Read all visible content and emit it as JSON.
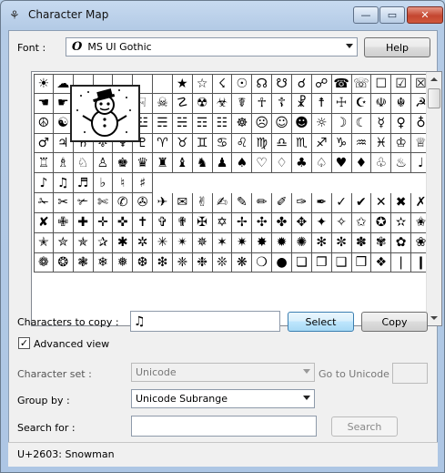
{
  "window": {
    "title": "Character Map",
    "app_icon": "⚘",
    "min": "—",
    "max": "▭",
    "close": "✕"
  },
  "font": {
    "label": "Font :",
    "value": "MS UI Gothic",
    "icon": "O",
    "help_label": "Help"
  },
  "grid": {
    "rows": [
      [
        "☀",
        "☁",
        "",
        "",
        "",
        "",
        "",
        "★",
        "☆",
        "☇",
        "☉",
        "☊",
        "☋",
        "☌",
        "☍",
        "☎",
        "☏",
        "☐",
        "☑",
        "☒",
        "☓"
      ],
      [
        "☚",
        "☛",
        "☜",
        "☝",
        "☞",
        "☟",
        "☠",
        "☡",
        "☢",
        "☣",
        "☤",
        "☥",
        "☦",
        "☧",
        "☨",
        "☩",
        "☪",
        "☫",
        "☬",
        "☭"
      ],
      [
        "☮",
        "☯",
        "☰",
        "☱",
        "☲",
        "☳",
        "☴",
        "☵",
        "☶",
        "☷",
        "☸",
        "☹",
        "☺",
        "☻",
        "☼",
        "☽",
        "☾",
        "☿",
        "♀",
        "♁"
      ],
      [
        "♂",
        "♃",
        "♄",
        "♅",
        "♆",
        "♇",
        "♈",
        "♉",
        "♊",
        "♋",
        "♌",
        "♍",
        "♎",
        "♏",
        "♐",
        "♑",
        "♒",
        "♓",
        "♔",
        "♕"
      ],
      [
        "♖",
        "♗",
        "♘",
        "♙",
        "♚",
        "♛",
        "♜",
        "♝",
        "♞",
        "♟",
        "♠",
        "♡",
        "♢",
        "♣",
        "♤",
        "♥",
        "♦",
        "♧",
        "♨",
        "♩"
      ],
      [
        "♪",
        "♫",
        "♬",
        "♭",
        "♮",
        "♯",
        "",
        "",
        "",
        "",
        "",
        "",
        "",
        "",
        "",
        "",
        "",
        "",
        "",
        ""
      ],
      [
        "✁",
        "✂",
        "✃",
        "✄",
        "✆",
        "✇",
        "✈",
        "✉",
        "✌",
        "✍",
        "✎",
        "✏",
        "✐",
        "✑",
        "✒",
        "✓",
        "✔",
        "✕",
        "✖",
        "✗"
      ],
      [
        "✘",
        "✙",
        "✚",
        "✛",
        "✜",
        "✝",
        "✞",
        "✟",
        "✠",
        "✡",
        "✢",
        "✣",
        "✤",
        "✥",
        "✦",
        "✧",
        "✩",
        "✪",
        "✫",
        "✬"
      ],
      [
        "✭",
        "✮",
        "✯",
        "✰",
        "✱",
        "✲",
        "✳",
        "✴",
        "✵",
        "✶",
        "✷",
        "✸",
        "✹",
        "✺",
        "✻",
        "✼",
        "✽",
        "✾",
        "✿",
        "❀"
      ],
      [
        "❁",
        "❂",
        "❃",
        "❄",
        "❅",
        "❆",
        "❇",
        "❈",
        "❉",
        "❊",
        "❋",
        "❍",
        "●",
        "❏",
        "❐",
        "❑",
        "❒",
        "❖",
        "❘",
        "❙"
      ]
    ],
    "zoomed_char": "☃"
  },
  "copy": {
    "label": "Characters to copy :",
    "value": "♫",
    "select_label": "Select",
    "copy_label": "Copy"
  },
  "advanced": {
    "label": "Advanced view",
    "checked": "✓"
  },
  "charset": {
    "label": "Character set :",
    "value": "Unicode",
    "goto_label": "Go to Unicode :",
    "goto_value": ""
  },
  "groupby": {
    "label": "Group by :",
    "value": "Unicode Subrange"
  },
  "search": {
    "label": "Search for :",
    "value": "",
    "button_label": "Search"
  },
  "status": {
    "text": "U+2603: Snowman"
  }
}
